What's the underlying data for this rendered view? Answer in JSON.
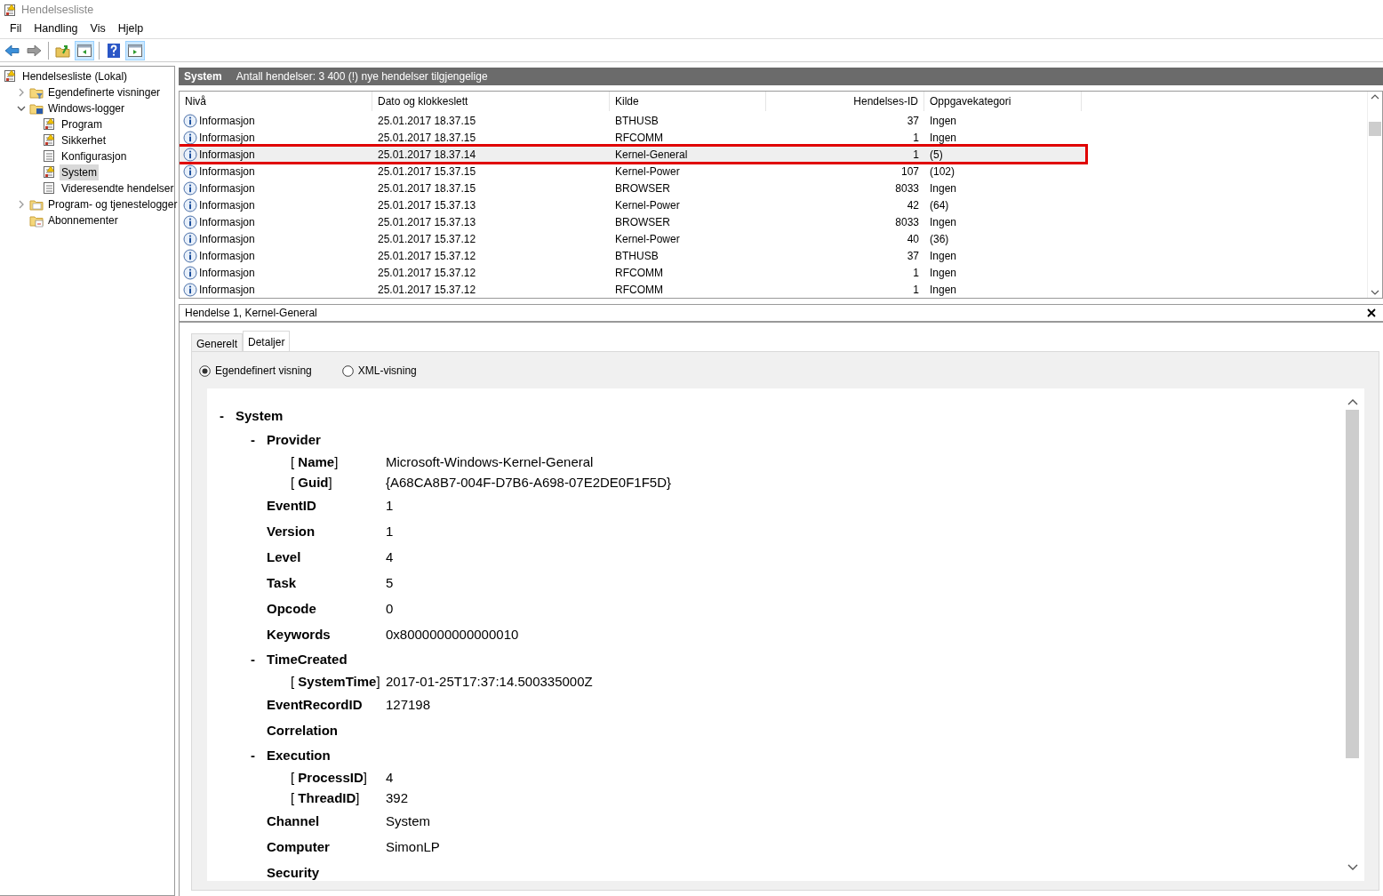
{
  "window": {
    "title": "Hendelsesliste"
  },
  "menu": [
    "Fil",
    "Handling",
    "Vis",
    "Hjelp"
  ],
  "toolbar": [
    {
      "kind": "back",
      "pressed": false
    },
    {
      "kind": "forward",
      "pressed": false
    },
    {
      "kind": "sep"
    },
    {
      "kind": "up",
      "pressed": false
    },
    {
      "kind": "tree",
      "pressed": true
    },
    {
      "kind": "sep"
    },
    {
      "kind": "help",
      "pressed": false
    },
    {
      "kind": "action",
      "pressed": true
    }
  ],
  "sidebar": {
    "items": [
      {
        "label": "Hendelsesliste (Lokal)",
        "kind": "root",
        "selected": false,
        "children": [
          {
            "label": "Egendefinerte visninger",
            "kind": "folder-filter",
            "selected": false,
            "expanded": false
          },
          {
            "label": "Windows-logger",
            "kind": "folder-logs",
            "selected": false,
            "expanded": true,
            "children": [
              {
                "label": "Program",
                "kind": "log-warn",
                "selected": false
              },
              {
                "label": "Sikkerhet",
                "kind": "log-warn",
                "selected": false
              },
              {
                "label": "Konfigurasjon",
                "kind": "log",
                "selected": false
              },
              {
                "label": "System",
                "kind": "log-warn",
                "selected": true
              },
              {
                "label": "Videresendte hendelser",
                "kind": "log",
                "selected": false
              }
            ]
          },
          {
            "label": "Program- og tjenestelogger",
            "kind": "folder",
            "selected": false,
            "expanded": false
          },
          {
            "label": "Abonnementer",
            "kind": "folder-calendar",
            "selected": false
          }
        ]
      }
    ]
  },
  "log_header": {
    "title": "System",
    "info": "Antall hendelser: 3 400 (!) nye hendelser tilgjengelige"
  },
  "table": {
    "columns": [
      "Nivå",
      "Dato og klokkeslett",
      "Kilde",
      "Hendelses-ID",
      "Oppgavekategori"
    ],
    "rows": [
      {
        "level": "Informasjon",
        "date": "25.01.2017 18.37.15",
        "source": "BTHUSB",
        "id": "37",
        "category": "Ingen",
        "selected": false
      },
      {
        "level": "Informasjon",
        "date": "25.01.2017 18.37.15",
        "source": "RFCOMM",
        "id": "1",
        "category": "Ingen",
        "selected": false
      },
      {
        "level": "Informasjon",
        "date": "25.01.2017 18.37.14",
        "source": "Kernel-General",
        "id": "1",
        "category": "(5)",
        "selected": true
      },
      {
        "level": "Informasjon",
        "date": "25.01.2017 15.37.15",
        "source": "Kernel-Power",
        "id": "107",
        "category": "(102)",
        "selected": false
      },
      {
        "level": "Informasjon",
        "date": "25.01.2017 18.37.15",
        "source": "BROWSER",
        "id": "8033",
        "category": "Ingen",
        "selected": false
      },
      {
        "level": "Informasjon",
        "date": "25.01.2017 15.37.13",
        "source": "Kernel-Power",
        "id": "42",
        "category": "(64)",
        "selected": false
      },
      {
        "level": "Informasjon",
        "date": "25.01.2017 15.37.13",
        "source": "BROWSER",
        "id": "8033",
        "category": "Ingen",
        "selected": false
      },
      {
        "level": "Informasjon",
        "date": "25.01.2017 15.37.12",
        "source": "Kernel-Power",
        "id": "40",
        "category": "(36)",
        "selected": false
      },
      {
        "level": "Informasjon",
        "date": "25.01.2017 15.37.12",
        "source": "BTHUSB",
        "id": "37",
        "category": "Ingen",
        "selected": false
      },
      {
        "level": "Informasjon",
        "date": "25.01.2017 15.37.12",
        "source": "RFCOMM",
        "id": "1",
        "category": "Ingen",
        "selected": false
      },
      {
        "level": "Informasjon",
        "date": "25.01.2017 15.37.12",
        "source": "RFCOMM",
        "id": "1",
        "category": "Ingen",
        "selected": false
      }
    ]
  },
  "detail": {
    "title": "Hendelse 1, Kernel-General",
    "tabs": [
      {
        "label": "Generelt",
        "selected": false
      },
      {
        "label": "Detaljer",
        "selected": true
      }
    ],
    "view_options": [
      {
        "label": "Egendefinert visning",
        "selected": true
      },
      {
        "label": "XML-visning",
        "selected": false
      }
    ],
    "tree": [
      {
        "kind": "section",
        "toggle": "-",
        "label": "System",
        "children": [
          {
            "kind": "section",
            "toggle": "-",
            "label": "Provider",
            "children": [
              {
                "kind": "attr",
                "label": "[ **Name**]",
                "value": "Microsoft-Windows-Kernel-General"
              },
              {
                "kind": "attr",
                "label": "[ **Guid**]",
                "value": "{A68CA8B7-004F-D7B6-A698-07E2DE0F1F5D}"
              }
            ]
          },
          {
            "kind": "field",
            "label": "EventID",
            "value": "1"
          },
          {
            "kind": "field",
            "label": "Version",
            "value": "1"
          },
          {
            "kind": "field",
            "label": "Level",
            "value": "4"
          },
          {
            "kind": "field",
            "label": "Task",
            "value": "5"
          },
          {
            "kind": "field",
            "label": "Opcode",
            "value": "0"
          },
          {
            "kind": "field",
            "label": "Keywords",
            "value": "0x8000000000000010"
          },
          {
            "kind": "section",
            "toggle": "-",
            "label": "TimeCreated",
            "children": [
              {
                "kind": "attr",
                "label": "[ **SystemTime**]",
                "value": "2017-01-25T17:37:14.500335000Z"
              }
            ]
          },
          {
            "kind": "field",
            "label": "EventRecordID",
            "value": "127198"
          },
          {
            "kind": "field",
            "label": "Correlation"
          },
          {
            "kind": "section",
            "toggle": "-",
            "label": "Execution",
            "children": [
              {
                "kind": "attr",
                "label": "[ **ProcessID**]",
                "value": "4"
              },
              {
                "kind": "attr",
                "label": "[ **ThreadID**]",
                "value": "392"
              }
            ]
          },
          {
            "kind": "field",
            "label": "Channel",
            "value": "System"
          },
          {
            "kind": "field",
            "label": "Computer",
            "value": "SimonLP"
          },
          {
            "kind": "field",
            "label": "Security"
          }
        ]
      }
    ]
  }
}
